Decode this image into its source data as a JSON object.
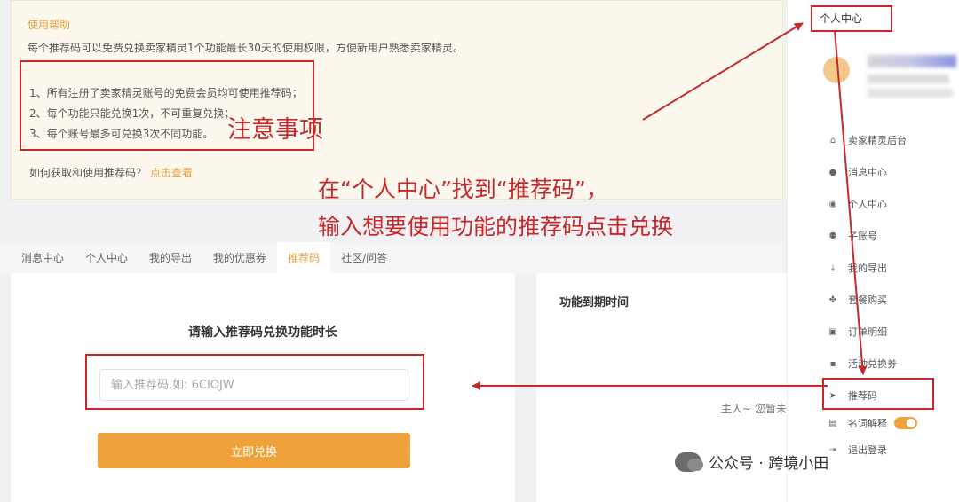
{
  "help": {
    "title": "使用帮助",
    "description": "每个推荐码可以免费兑换卖家精灵1个功能最长30天的使用权限，方便新用户熟悉卖家精灵。",
    "rules": [
      "1、所有注册了卖家精灵账号的免费会员均可使用推荐码；",
      "2、每个功能只能兑换1次，不可重复兑换；",
      "3、每个账号最多可兑换3次不同功能。"
    ],
    "question": "如何获取和使用推荐码？",
    "link": "点击查看"
  },
  "tabs": [
    {
      "label": "消息中心",
      "active": false
    },
    {
      "label": "个人中心",
      "active": false
    },
    {
      "label": "我的导出",
      "active": false
    },
    {
      "label": "我的优惠券",
      "active": false
    },
    {
      "label": "推荐码",
      "active": true
    },
    {
      "label": "社区/问答",
      "active": false
    }
  ],
  "redeem": {
    "title": "请输入推荐码兑换功能时长",
    "placeholder": "输入推荐码,如: 6CIOJW",
    "button": "立即兑换"
  },
  "expiry": {
    "title": "功能到期时间",
    "empty": "主人~ 您暂未"
  },
  "menu": {
    "header": "个人中心",
    "items": [
      {
        "label": "卖家精灵后台",
        "icon": "home-icon"
      },
      {
        "label": "消息中心",
        "icon": "message-icon"
      },
      {
        "label": "个人中心",
        "icon": "user-icon"
      },
      {
        "label": "子账号",
        "icon": "users-icon"
      },
      {
        "label": "我的导出",
        "icon": "download-icon"
      },
      {
        "label": "套餐购买",
        "icon": "package-icon"
      },
      {
        "label": "订单明细",
        "icon": "order-icon"
      },
      {
        "label": "活动兑换券",
        "icon": "coupon-icon"
      },
      {
        "label": "推荐码",
        "icon": "send-icon"
      },
      {
        "label": "名词解释",
        "icon": "glossary-icon",
        "toggle": true
      },
      {
        "label": "退出登录",
        "icon": "logout-icon"
      }
    ]
  },
  "annotations": {
    "notes": "注意事项",
    "instruction_line1": "在“个人中心”找到“推荐码”，",
    "instruction_line2": "输入想要使用功能的推荐码点击兑换",
    "color": "#c7282b"
  },
  "watermark": "公众号 · 跨境小田",
  "colors": {
    "accent": "#f0a23a",
    "annotation": "#c7282b"
  }
}
